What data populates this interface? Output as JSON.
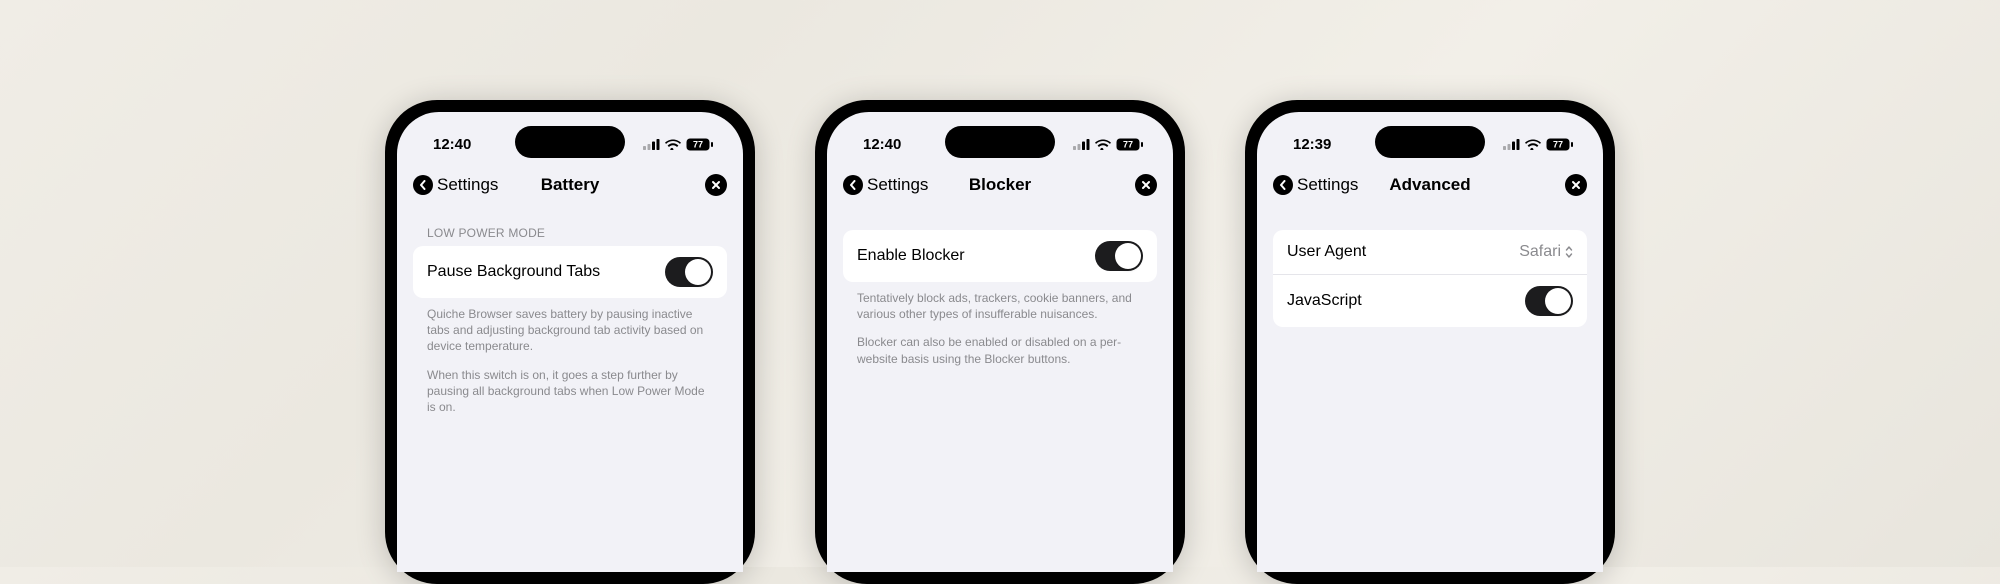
{
  "phones": [
    {
      "time": "12:40",
      "battery": "77",
      "back": "Settings",
      "title": "Battery",
      "section_header": "LOW POWER MODE",
      "rows": [
        {
          "label": "Pause Background Tabs",
          "type": "toggle",
          "on": true
        }
      ],
      "footers": [
        "Quiche Browser saves battery by pausing inactive tabs and adjusting background tab activity based on device temperature.",
        "When this switch is on, it goes a step further by pausing all background tabs when Low Power Mode is on."
      ]
    },
    {
      "time": "12:40",
      "battery": "77",
      "back": "Settings",
      "title": "Blocker",
      "rows": [
        {
          "label": "Enable Blocker",
          "type": "toggle",
          "on": true
        }
      ],
      "footers": [
        "Tentatively block ads, trackers, cookie banners, and various other types of insufferable nuisances.",
        "Blocker can also be enabled or disabled on a per-website basis using the Blocker buttons."
      ]
    },
    {
      "time": "12:39",
      "battery": "77",
      "back": "Settings",
      "title": "Advanced",
      "rows": [
        {
          "label": "User Agent",
          "type": "select",
          "value": "Safari"
        },
        {
          "label": "JavaScript",
          "type": "toggle",
          "on": true
        }
      ],
      "footers": []
    }
  ]
}
